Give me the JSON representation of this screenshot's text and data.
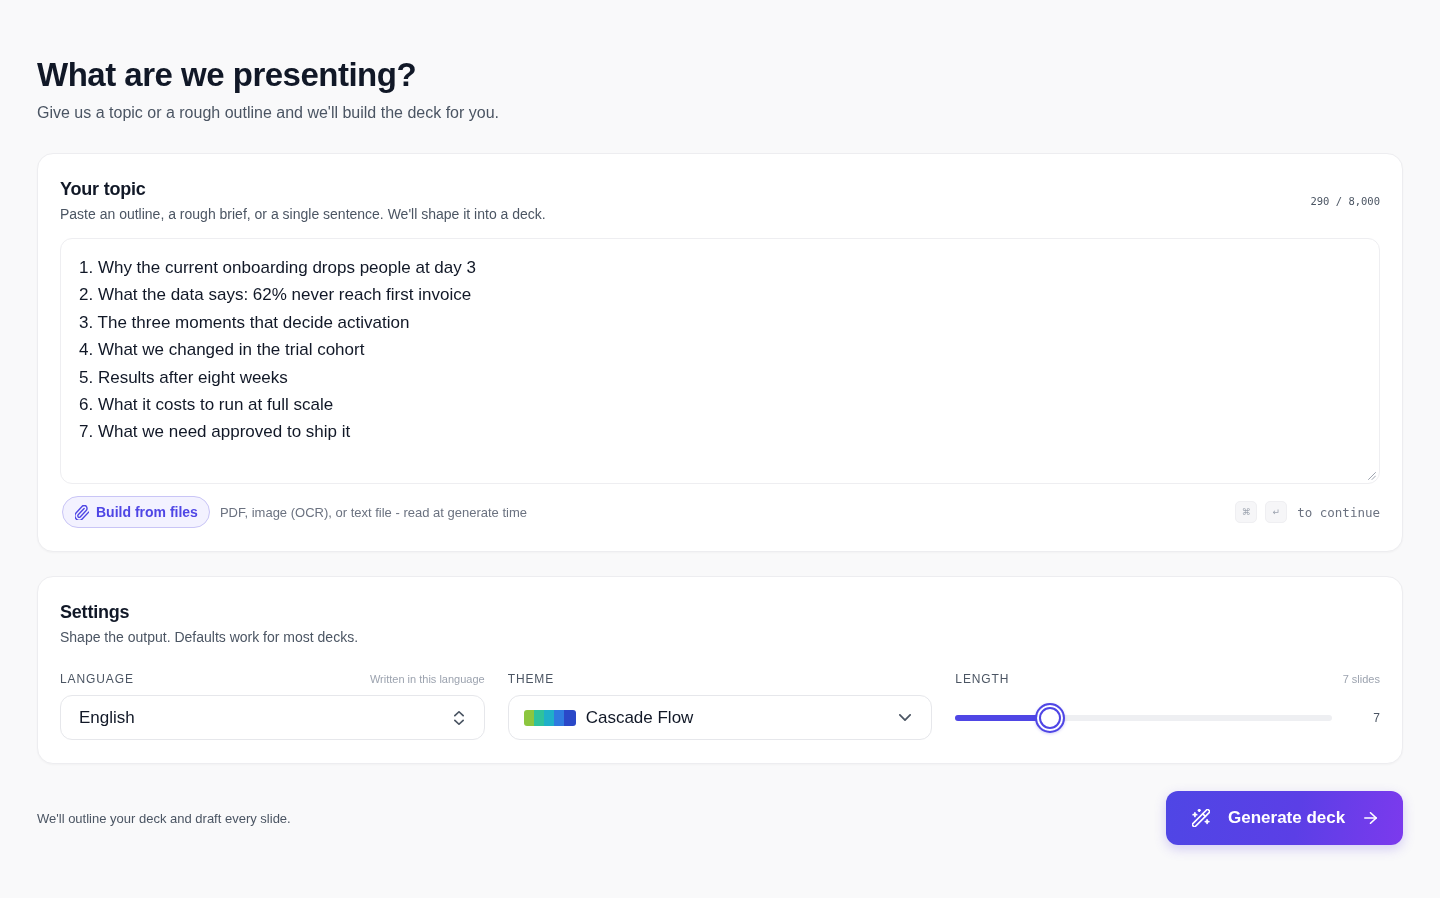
{
  "header": {
    "title": "What are we presenting?",
    "subtitle": "Give us a topic or a rough outline and we'll build the deck for you."
  },
  "topic": {
    "title": "Your topic",
    "description": "Paste an outline, a rough brief, or a single sentence. We'll shape it into a deck.",
    "counter": "290 / 8,000",
    "lines": [
      "1. Why the current onboarding drops people at day 3",
      "2. What the data says: 62% never reach first invoice",
      "3. The three moments that decide activation",
      "4. What we changed in the trial cohort",
      "5. Results after eight weeks",
      "6. What it costs to run at full scale",
      "7. What we need approved to ship it"
    ],
    "upload_button": "Build from files",
    "upload_hint": "PDF, image (OCR), or text file - read at generate time",
    "shortcut": {
      "keys": [
        "⌘",
        "↵"
      ],
      "label": "to continue"
    }
  },
  "settings": {
    "title": "Settings",
    "description": "Shape the output. Defaults work for most decks.",
    "fields": [
      {
        "kind": "select",
        "label": "LANGUAGE",
        "hint": "Written in this language",
        "value": "English"
      },
      {
        "kind": "theme",
        "label": "THEME",
        "value": "Cascade Flow"
      },
      {
        "kind": "slider",
        "label": "LENGTH",
        "hint": "7 slides",
        "level": 0.25,
        "reading": "7"
      }
    ]
  },
  "footer": {
    "note": "We'll outline your deck and draft every slide.",
    "button": "Generate deck"
  }
}
